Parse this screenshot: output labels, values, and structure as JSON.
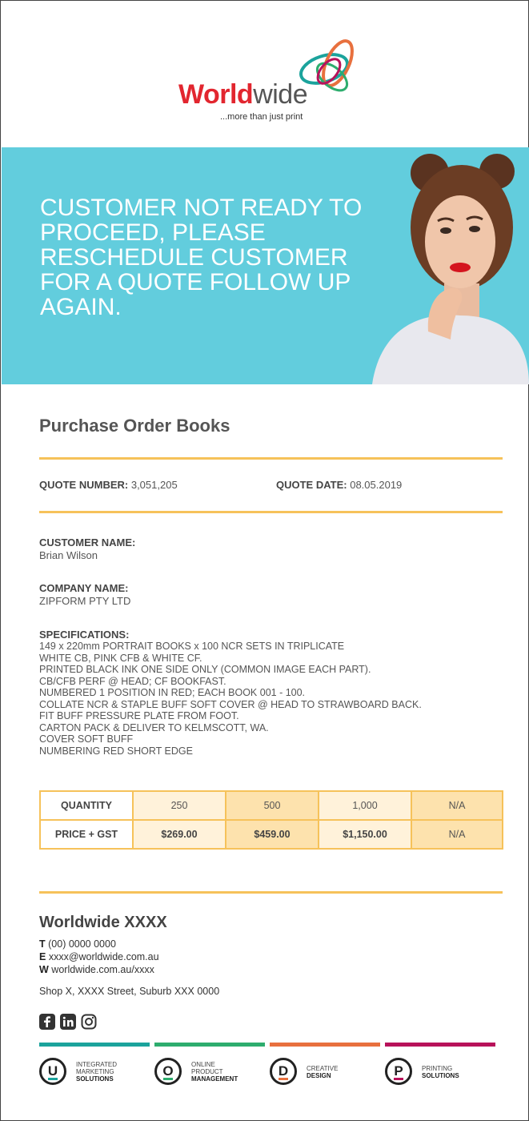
{
  "header": {
    "logo_bold": "World",
    "logo_light": "wide",
    "tagline": "...more than just print"
  },
  "banner": {
    "text": "CUSTOMER NOT READY TO PROCEED, PLEASE RESCHEDULE CUSTOMER FOR A QUOTE FOLLOW UP AGAIN.",
    "color": "#62cddd"
  },
  "document": {
    "title": "Purchase Order Books",
    "quote_number_label": "QUOTE NUMBER:",
    "quote_number": "3,051,205",
    "quote_date_label": "QUOTE DATE:",
    "quote_date": "08.05.2019",
    "customer_label": "CUSTOMER NAME:",
    "customer": "Brian Wilson",
    "company_label": "COMPANY NAME:",
    "company": "ZIPFORM PTY LTD",
    "specs_label": "SPECIFICATIONS:",
    "specs": [
      "149 x 220mm PORTRAIT BOOKS x 100 NCR SETS IN TRIPLICATE",
      "WHITE CB, PINK CFB & WHITE CF.",
      "PRINTED BLACK INK ONE SIDE ONLY (COMMON IMAGE EACH PART).",
      "CB/CFB PERF @ HEAD; CF BOOKFAST.",
      "NUMBERED 1 POSITION IN RED; EACH BOOK 001 - 100.",
      "COLLATE NCR & STAPLE BUFF SOFT COVER @ HEAD TO STRAWBOARD BACK.",
      "FIT BUFF PRESSURE PLATE FROM FOOT.",
      "CARTON PACK & DELIVER TO KELMSCOTT, WA.",
      "COVER SOFT BUFF",
      "NUMBERING RED SHORT EDGE"
    ]
  },
  "pricing": {
    "quantity_label": "QUANTITY",
    "price_label": "PRICE + GST",
    "quantities": [
      "250",
      "500",
      "1,000",
      "N/A"
    ],
    "prices": [
      "$269.00",
      "$459.00",
      "$1,150.00",
      "N/A"
    ]
  },
  "footer": {
    "company": "Worldwide XXXX",
    "phone_label": "T",
    "phone": "(00) 0000 0000",
    "email_label": "E",
    "email": "xxxx@worldwide.com.au",
    "web_label": "W",
    "web": "worldwide.com.au/xxxx",
    "address": "Shop X, XXXX Street, Suburb XXX 0000",
    "services": [
      {
        "letter": "U",
        "line1": "INTEGRATED",
        "line2": "MARKETING",
        "line3": "SOLUTIONS",
        "color": "#1ba39c"
      },
      {
        "letter": "O",
        "line1": "ONLINE",
        "line2": "PRODUCT",
        "line3": "MANAGEMENT",
        "color": "#2ead6e"
      },
      {
        "letter": "D",
        "line1": "CREATIVE",
        "line2": "",
        "line3": "DESIGN",
        "color": "#e8703e"
      },
      {
        "letter": "P",
        "line1": "PRINTING",
        "line2": "",
        "line3": "SOLUTIONS",
        "color": "#b8125a"
      }
    ],
    "social_icons": [
      "facebook-icon",
      "linkedin-icon",
      "instagram-icon"
    ]
  },
  "colors": {
    "accent_rule": "#f6c25a",
    "brand_red": "#e2262f"
  }
}
